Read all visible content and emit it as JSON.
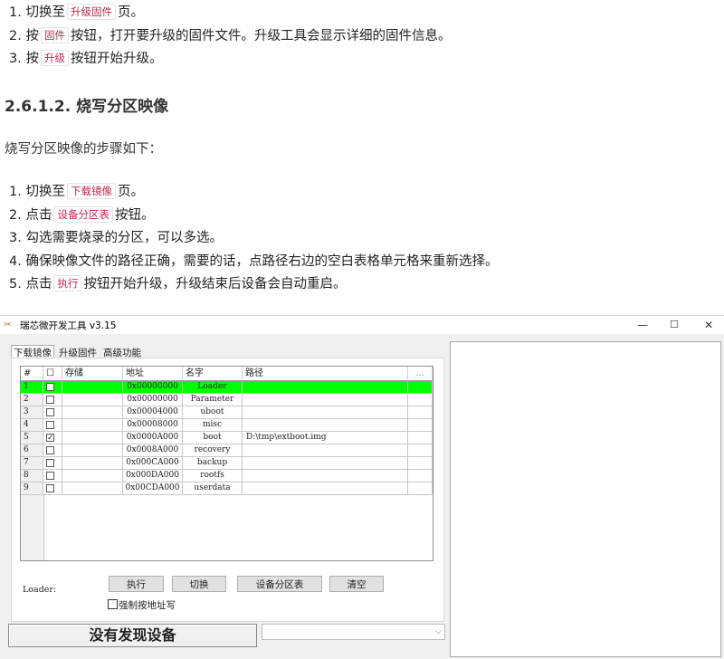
{
  "steps1": [
    {
      "num": "1.",
      "pre": "切换至",
      "tag": "升级固件",
      "post": "页。"
    },
    {
      "num": "2.",
      "pre": "按",
      "tag": "固件",
      "post": "按钮，打开要升级的固件文件。升级工具会显示详细的固件信息。"
    },
    {
      "num": "3.",
      "pre": "按",
      "tag": "升级",
      "post": "按钮开始升级。"
    }
  ],
  "heading": "2.6.1.2. 烧写分区映像",
  "intro": "烧写分区映像的步骤如下：",
  "steps2": [
    {
      "num": "1.",
      "pre": "切换至",
      "tag": "下载镜像",
      "post": "页。"
    },
    {
      "num": "2.",
      "pre": "点击",
      "tag": "设备分区表",
      "post": "按钮。"
    },
    {
      "num": "3.",
      "pre": "勾选需要烧录的分区，可以多选。",
      "tag": "",
      "post": ""
    },
    {
      "num": "4.",
      "pre": "确保映像文件的路径正确，需要的话，点路径右边的空白表格单元格来重新选择。",
      "tag": "",
      "post": ""
    },
    {
      "num": "5.",
      "pre": "点击",
      "tag": "执行",
      "post": "按钮开始升级，升级结束后设备会自动重启。"
    }
  ],
  "window": {
    "title": "瑞芯微开发工具 v3.15",
    "controls": {
      "minimize": "—",
      "maximize": "☐",
      "close": "✕"
    },
    "tabs": [
      "下载镜像",
      "升级固件",
      "高级功能"
    ],
    "grid": {
      "headers": [
        "#",
        "☐",
        "存储",
        "地址",
        "名字",
        "路径",
        "..."
      ],
      "rows": [
        {
          "n": "1",
          "checked": false,
          "storage": "",
          "addr": "0x00000000",
          "name": "Loader",
          "path": "",
          "highlight": true
        },
        {
          "n": "2",
          "checked": false,
          "storage": "",
          "addr": "0x00000000",
          "name": "Parameter",
          "path": ""
        },
        {
          "n": "3",
          "checked": false,
          "storage": "",
          "addr": "0x00004000",
          "name": "uboot",
          "path": ""
        },
        {
          "n": "4",
          "checked": false,
          "storage": "",
          "addr": "0x00008000",
          "name": "misc",
          "path": ""
        },
        {
          "n": "5",
          "checked": true,
          "storage": "",
          "addr": "0x0000A000",
          "name": "boot",
          "path": "D:\\tmp\\extboot.img"
        },
        {
          "n": "6",
          "checked": false,
          "storage": "",
          "addr": "0x0008A000",
          "name": "recovery",
          "path": ""
        },
        {
          "n": "7",
          "checked": false,
          "storage": "",
          "addr": "0x000CA000",
          "name": "backup",
          "path": ""
        },
        {
          "n": "8",
          "checked": false,
          "storage": "",
          "addr": "0x000DA000",
          "name": "rootfs",
          "path": ""
        },
        {
          "n": "9",
          "checked": false,
          "storage": "",
          "addr": "0x00CDA000",
          "name": "userdata",
          "path": ""
        }
      ]
    },
    "loader_label": "Loader:",
    "buttons": {
      "execute": "执行",
      "switch": "切换",
      "partition": "设备分区表",
      "clear": "清空"
    },
    "force_label": "强制按地址写",
    "status": "没有发现设备",
    "combo_value": "",
    "colors": {
      "highlight": "#00ff00",
      "tag": "#c7254e"
    }
  }
}
